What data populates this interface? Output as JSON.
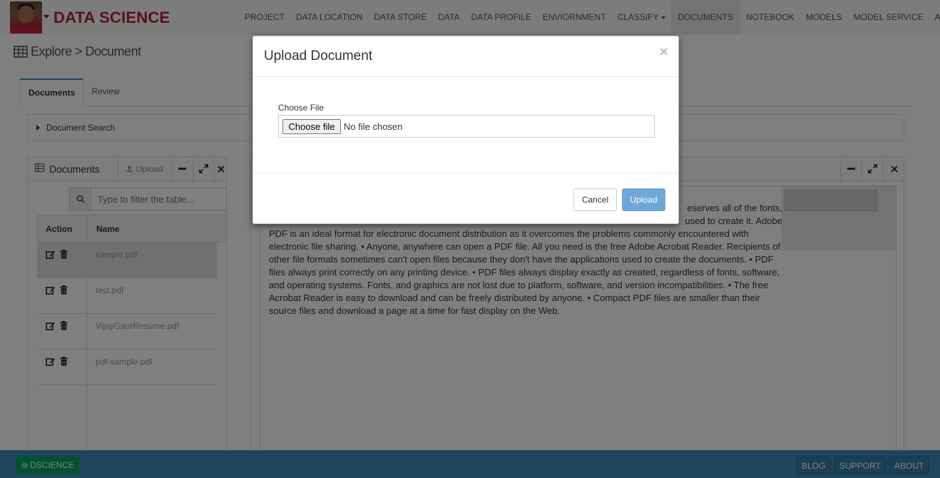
{
  "app": {
    "brand": "DATA SCIENCE"
  },
  "nav": {
    "items": [
      {
        "label": "PROJECT"
      },
      {
        "label": "DATA LOCATION"
      },
      {
        "label": "DATA STORE"
      },
      {
        "label": "DATA"
      },
      {
        "label": "DATA PROFILE"
      },
      {
        "label": "ENVIORNMENT"
      },
      {
        "label": "CLASSIFY"
      },
      {
        "label": "DOCUMENTS",
        "active": true
      },
      {
        "label": "NOTEBOOK"
      },
      {
        "label": "MODELS"
      },
      {
        "label": "MODEL SERVICE"
      },
      {
        "label": "AUDIT"
      }
    ]
  },
  "breadcrumb": {
    "text": "Explore > Document"
  },
  "tabs": [
    {
      "label": "Documents",
      "active": true
    },
    {
      "label": "Review"
    }
  ],
  "search_panel": {
    "label": "Document Search"
  },
  "documents_widget": {
    "title": "Documents",
    "upload_label": "Upload",
    "filter_placeholder": "Type to filter the table...",
    "columns": {
      "action": "Action",
      "name": "Name"
    },
    "rows": [
      {
        "name": "sample.pdf",
        "selected": true
      },
      {
        "name": "test.pdf"
      },
      {
        "name": "VijayGaurResume.pdf"
      },
      {
        "name": "pdf-sample.pdf"
      }
    ]
  },
  "viewer": {
    "text": "eserves all of the fonts, used to create it. Adobe PDF is an ideal format for electronic document distribution as it overcomes the problems commonly encountered with electronic file sharing. • Anyone, anywhere can open a PDF file. All you need is the free Adobe Acrobat Reader. Recipients of other file formats sometimes can't open files because they don't have the applications used to create the documents. • PDF files always print correctly on any printing device. • PDF files always display exactly as created, regardless of fonts, software, and operating systems. Fonts, and graphics are not lost due to platform, software, and version incompatibilities. • The free Acrobat Reader is easy to download and can be freely distributed by anyone. • Compact PDF files are smaller than their source files and download a page at a time for fast display on the Web.",
    "text_line1": "eserves all of the fonts,",
    "text_line2": "used to create it. Adobe",
    "text_rest": "PDF is an ideal format for electronic document distribution as it overcomes the problems commonly encountered with electronic file sharing. • Anyone, anywhere can open a PDF file. All you need is the free Adobe Acrobat Reader. Recipients of other file formats sometimes can't open files because they don't have the applications used to create the documents. • PDF files always print correctly on any printing device. • PDF files always display exactly as created, regardless of fonts, software, and operating systems. Fonts, and graphics are not lost due to platform, software, and version incompatibilities. • The free Acrobat Reader is easy to download and can be freely distributed by anyone. • Compact PDF files are smaller than their source files and download a page at a time for fast display on the Web."
  },
  "footer": {
    "brand": "DSCIENCE",
    "links": [
      {
        "label": "BLOG"
      },
      {
        "label": "SUPPORT"
      },
      {
        "label": "ABOUT"
      }
    ]
  },
  "modal": {
    "title": "Upload Document",
    "close": "×",
    "field_label": "Choose File",
    "file_button": "Choose file",
    "file_status": "No file chosen",
    "cancel_label": "Cancel",
    "upload_label": "Upload"
  },
  "colors": {
    "brand": "#b22234",
    "footer": "#3c8dbc",
    "dscience_badge": "#00a65a",
    "primary_button": "#6fa8d6",
    "tab_accent": "#3c8dbc"
  }
}
